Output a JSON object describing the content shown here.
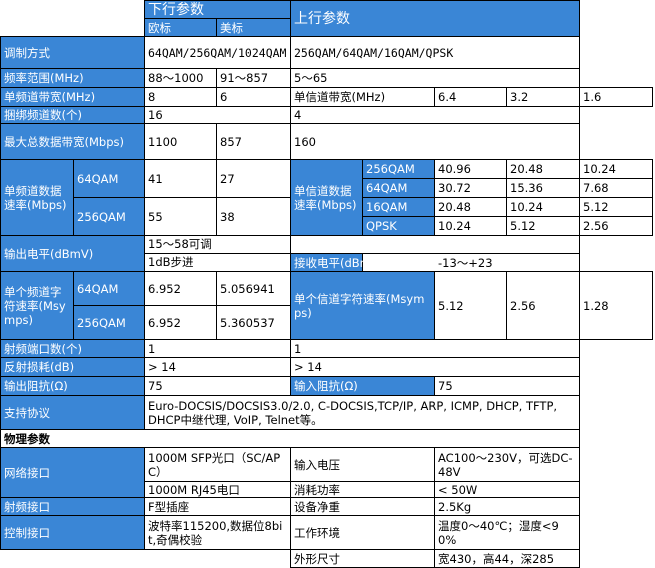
{
  "header": {
    "downlink": "下行参数",
    "uplink": "上行参数",
    "euro": "欧标",
    "us": "美标"
  },
  "rows": {
    "modulation": {
      "label": "调制方式",
      "down": "64QAM/256QAM/1024QAM",
      "up": "256QAM/64QAM/16QAM/QPSK"
    },
    "freq": {
      "label": "频率范围(MHz)",
      "euro": "88～1000",
      "us": "91～857",
      "up": "5～65"
    },
    "chbw": {
      "label": "单频道带宽(MHz)",
      "euro": "8",
      "us": "6",
      "up_label": "单信道带宽(MHz)",
      "up1": "6.4",
      "up2": "3.2",
      "up3": "1.6"
    },
    "bond": {
      "label": "捆绑频道数(个)",
      "down": "16",
      "up": "4"
    },
    "maxbw": {
      "label": "最大总数据带宽(Mbps)",
      "euro": "1100",
      "us": "857",
      "up": "160"
    },
    "rate": {
      "label": "单频道数据速率(Mbps)",
      "q64": "64QAM",
      "q64_euro": "41",
      "q64_us": "27",
      "q256": "256QAM",
      "q256_euro": "55",
      "q256_us": "38",
      "up_label": "单信道数据速率(Mbps)",
      "up_rows": [
        {
          "mod": "256QAM",
          "v1": "40.96",
          "v2": "20.48",
          "v3": "10.24"
        },
        {
          "mod": "64QAM",
          "v1": "30.72",
          "v2": "15.36",
          "v3": "7.68"
        },
        {
          "mod": "16QAM",
          "v1": "20.48",
          "v2": "10.24",
          "v3": "5.12"
        },
        {
          "mod": "QPSK",
          "v1": "10.24",
          "v2": "5.12",
          "v3": "2.56"
        }
      ]
    },
    "outlevel": {
      "label": "输出电平(dBmV)",
      "line1": "15～58可调",
      "line2": "1dB步进"
    },
    "rxlevel": {
      "label": "接收电平(dBmV)",
      "value": "-13～+23"
    },
    "symrate": {
      "label": "单个频道字符速率(Msymps)",
      "q64": "64QAM",
      "q64_euro": "6.952",
      "q64_us": "5.056941",
      "q256": "256QAM",
      "q256_euro": "6.952",
      "q256_us": "5.360537",
      "up_label": "单个信道字符速率(Msymps)",
      "up1": "5.12",
      "up2": "2.56",
      "up3": "1.28"
    },
    "rfports": {
      "label": "射频端口数(个)",
      "down": "1",
      "up": "1"
    },
    "returnloss": {
      "label": "反射损耗(dB)",
      "down": "> 14",
      "up": "> 14"
    },
    "impedance": {
      "label": "输出阻抗(Ω)",
      "down": "75",
      "up_label": "输入阻抗(Ω)",
      "up": "75"
    },
    "protocol": {
      "label": "支持协议",
      "value": "Euro-DOCSIS/DOCSIS3.0/2.0, C-DOCSIS,TCP/IP, ARP, ICMP, DHCP, TFTP, DHCP中继代理, VoIP, Telnet等。"
    }
  },
  "physical": {
    "title": "物理参数",
    "net_label": "网络接口",
    "net1": "1000M SFP光口（SC/APC）",
    "net2": "1000M RJ45电口",
    "volt_label": "输入电压",
    "volt": "AC100～230V，可选DC-48V",
    "power_label": "消耗功率",
    "power": "< 50W",
    "rf_label": "射频接口",
    "rf": "F型插座",
    "weight_label": "设备净重",
    "weight": "2.5Kg",
    "ctrl_label": "控制接口",
    "ctrl": "波特率115200,数据位8bit,奇偶校验",
    "env_label": "工作环境",
    "env": "温度0～40℃；湿度<90%",
    "size_label": "外形尺寸",
    "size": "宽430，高44，深285"
  }
}
